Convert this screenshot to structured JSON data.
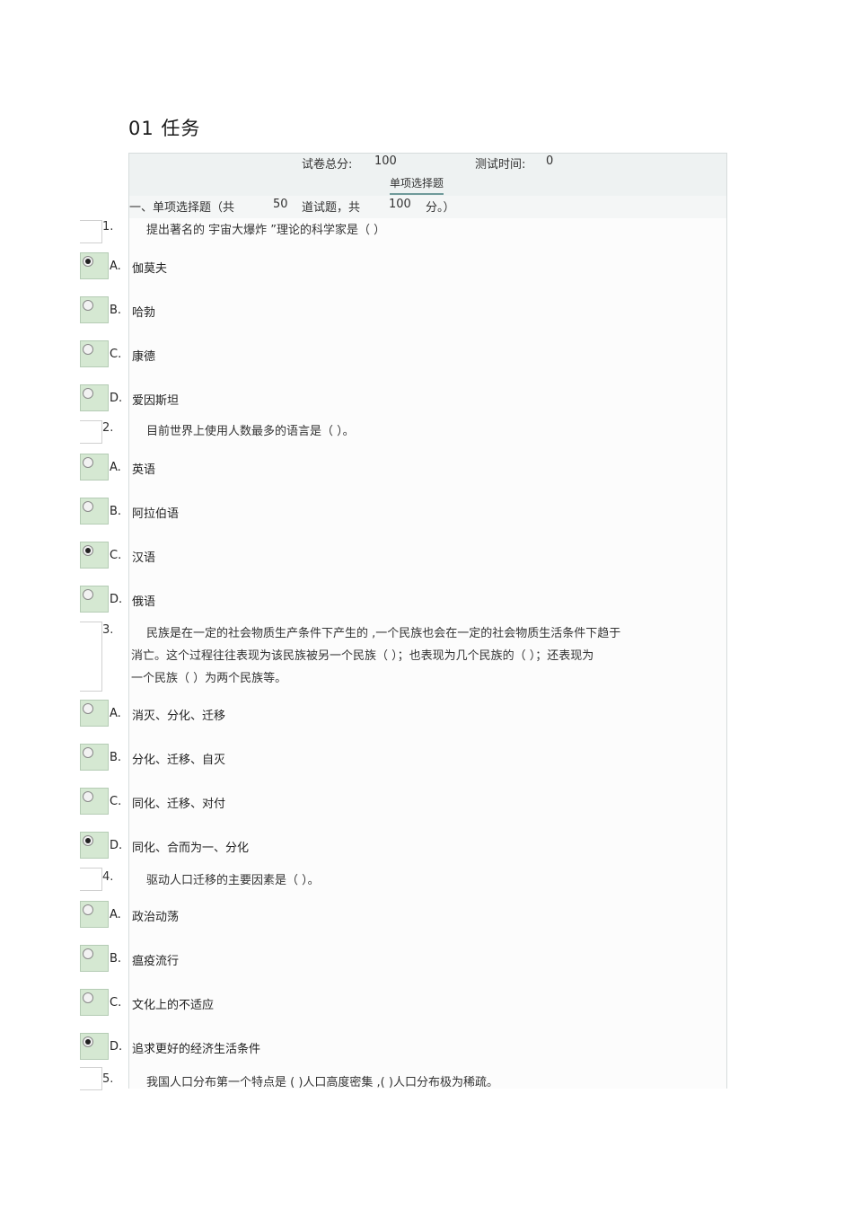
{
  "title": "01 任务",
  "header": {
    "score_label": "试卷总分:",
    "score_value": "100",
    "time_label": "测试时间:",
    "time_value": "0",
    "tab": "单项选择题"
  },
  "section": {
    "prefix": "一、单项选择题（共",
    "count": "50",
    "mid": "道试题，共",
    "points": "100",
    "suffix": "分。）"
  },
  "questions": [
    {
      "num": "1.",
      "lines": [
        "提出著名的    宇宙大爆炸  ”理论的科学家是（          ）"
      ],
      "options": [
        {
          "letter": "A.",
          "text": "伽莫夫",
          "selected": true
        },
        {
          "letter": "B.",
          "text": "哈勃",
          "selected": false
        },
        {
          "letter": "C.",
          "text": "康德",
          "selected": false
        },
        {
          "letter": "D.",
          "text": "爱因斯坦",
          "selected": false
        }
      ]
    },
    {
      "num": "2.",
      "lines": [
        "目前世界上使用人数最多的语言是（            ）。"
      ],
      "options": [
        {
          "letter": "A.",
          "text": "英语",
          "selected": false
        },
        {
          "letter": "B.",
          "text": "阿拉伯语",
          "selected": false
        },
        {
          "letter": "C.",
          "text": "汉语",
          "selected": true
        },
        {
          "letter": "D.",
          "text": "俄语",
          "selected": false
        }
      ]
    },
    {
      "num": "3.",
      "lines": [
        "民族是在一定的社会物质生产条件下产生的          ,一个民族也会在一定的社会物质生活条件下趋于",
        "消亡。这个过程往往表现为该民族被另一个民族（              ）；也表现为几个民族的（          ）；还表现为",
        "一个民族（      ）为两个民族等。"
      ],
      "options": [
        {
          "letter": "A.",
          "text": "消灭、分化、迁移",
          "selected": false
        },
        {
          "letter": "B.",
          "text": "分化、迁移、自灭",
          "selected": false
        },
        {
          "letter": "C.",
          "text": "同化、迁移、对付",
          "selected": false
        },
        {
          "letter": "D.",
          "text": "同化、合而为一、分化",
          "selected": true
        }
      ]
    },
    {
      "num": "4.",
      "lines": [
        "驱动人口迁移的主要因素是（          ）。"
      ],
      "options": [
        {
          "letter": "A.",
          "text": "政治动荡",
          "selected": false
        },
        {
          "letter": "B.",
          "text": "瘟疫流行",
          "selected": false
        },
        {
          "letter": "C.",
          "text": "文化上的不适应",
          "selected": false
        },
        {
          "letter": "D.",
          "text": "追求更好的经济生活条件",
          "selected": true
        }
      ]
    },
    {
      "num": "5.",
      "lines": [
        "我国人口分布第一个特点是      (          )人口高度密集    ,(          )人口分布极为稀疏。"
      ],
      "options": []
    }
  ]
}
